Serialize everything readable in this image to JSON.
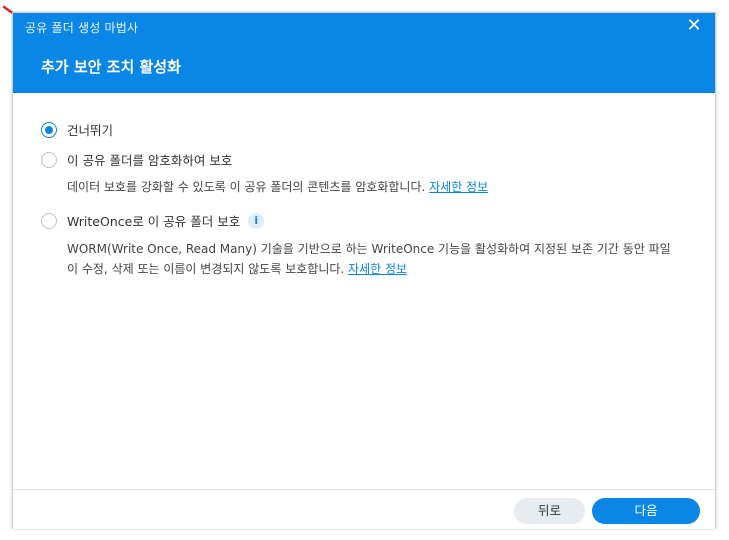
{
  "window": {
    "title": "공유 폴더 생성 마법사",
    "close_symbol": "✕"
  },
  "step": {
    "title": "추가 보안 조치 활성화"
  },
  "options": [
    {
      "label": "건너뛰기",
      "selected": true
    },
    {
      "label": "이 공유 폴더를 암호화하여 보호",
      "selected": false,
      "description": "데이터 보호를 강화할 수 있도록 이 공유 폴더의 콘텐츠를 암호화합니다. ",
      "link": "자세한 정보"
    },
    {
      "label": "WriteOnce로 이 공유 폴더 보호",
      "selected": false,
      "info_icon": "i",
      "description_line1": "WORM(Write Once, Read Many) 기술을 기반으로 하는 WriteOnce 기능을 활성화하여 지정된 보존 기간 동안 파일",
      "description_line2": "이 수정, 삭제 또는 이름이 변경되지 않도록 보호합니다. ",
      "link": "자세한 정보"
    }
  ],
  "footer": {
    "back_label": "뒤로",
    "next_label": "다음"
  },
  "colors": {
    "accent": "#0a86e6",
    "annotation_arrow": "#e02020"
  }
}
